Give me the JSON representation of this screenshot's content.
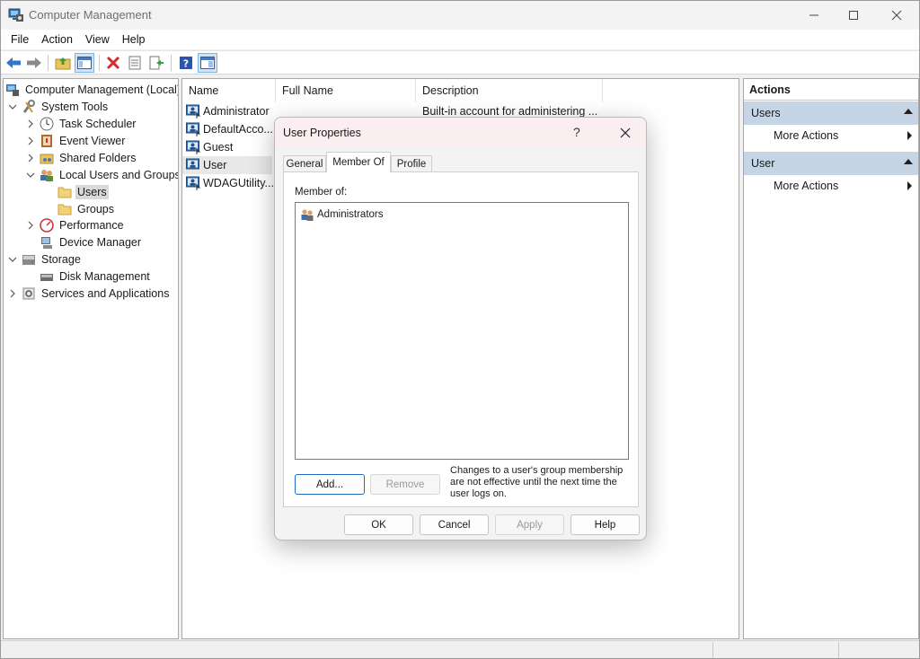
{
  "window": {
    "title": "Computer Management",
    "minimize_label": "Minimize",
    "maximize_label": "Maximize",
    "close_label": "Close"
  },
  "menu": [
    "File",
    "Action",
    "View",
    "Help"
  ],
  "tree": {
    "root": "Computer Management (Local)",
    "system_tools": "System Tools",
    "task_scheduler": "Task Scheduler",
    "event_viewer": "Event Viewer",
    "shared_folders": "Shared Folders",
    "local_users_groups": "Local Users and Groups",
    "users": "Users",
    "groups": "Groups",
    "performance": "Performance",
    "device_manager": "Device Manager",
    "storage": "Storage",
    "disk_management": "Disk Management",
    "services_apps": "Services and Applications"
  },
  "list": {
    "columns": [
      "Name",
      "Full Name",
      "Description"
    ],
    "rows": [
      {
        "name": "Administrator",
        "full_name": "",
        "description": "Built-in account for administering ..."
      },
      {
        "name": "DefaultAcco...",
        "full_name": "",
        "description": ""
      },
      {
        "name": "Guest",
        "full_name": "",
        "description": ""
      },
      {
        "name": "User",
        "full_name": "",
        "description": ""
      },
      {
        "name": "WDAGUtility...",
        "full_name": "",
        "description": ""
      }
    ]
  },
  "actions": {
    "title": "Actions",
    "section1": "Users",
    "section1_item": "More Actions",
    "section2": "User",
    "section2_item": "More Actions"
  },
  "dialog": {
    "title": "User Properties",
    "help": "?",
    "tabs": [
      "General",
      "Member Of",
      "Profile"
    ],
    "active_tab": "Member Of",
    "member_of_label": "Member of:",
    "members": [
      "Administrators"
    ],
    "add_button": "Add...",
    "remove_button": "Remove",
    "note": "Changes to a user's group membership are not effective until the next time the user logs on.",
    "ok_button": "OK",
    "cancel_button": "Cancel",
    "apply_button": "Apply",
    "help_button": "Help"
  },
  "colors": {
    "accent": "#1b6ac9",
    "actions_section": "#c5d5e6",
    "dialog_title_bg": "#faeef0"
  }
}
